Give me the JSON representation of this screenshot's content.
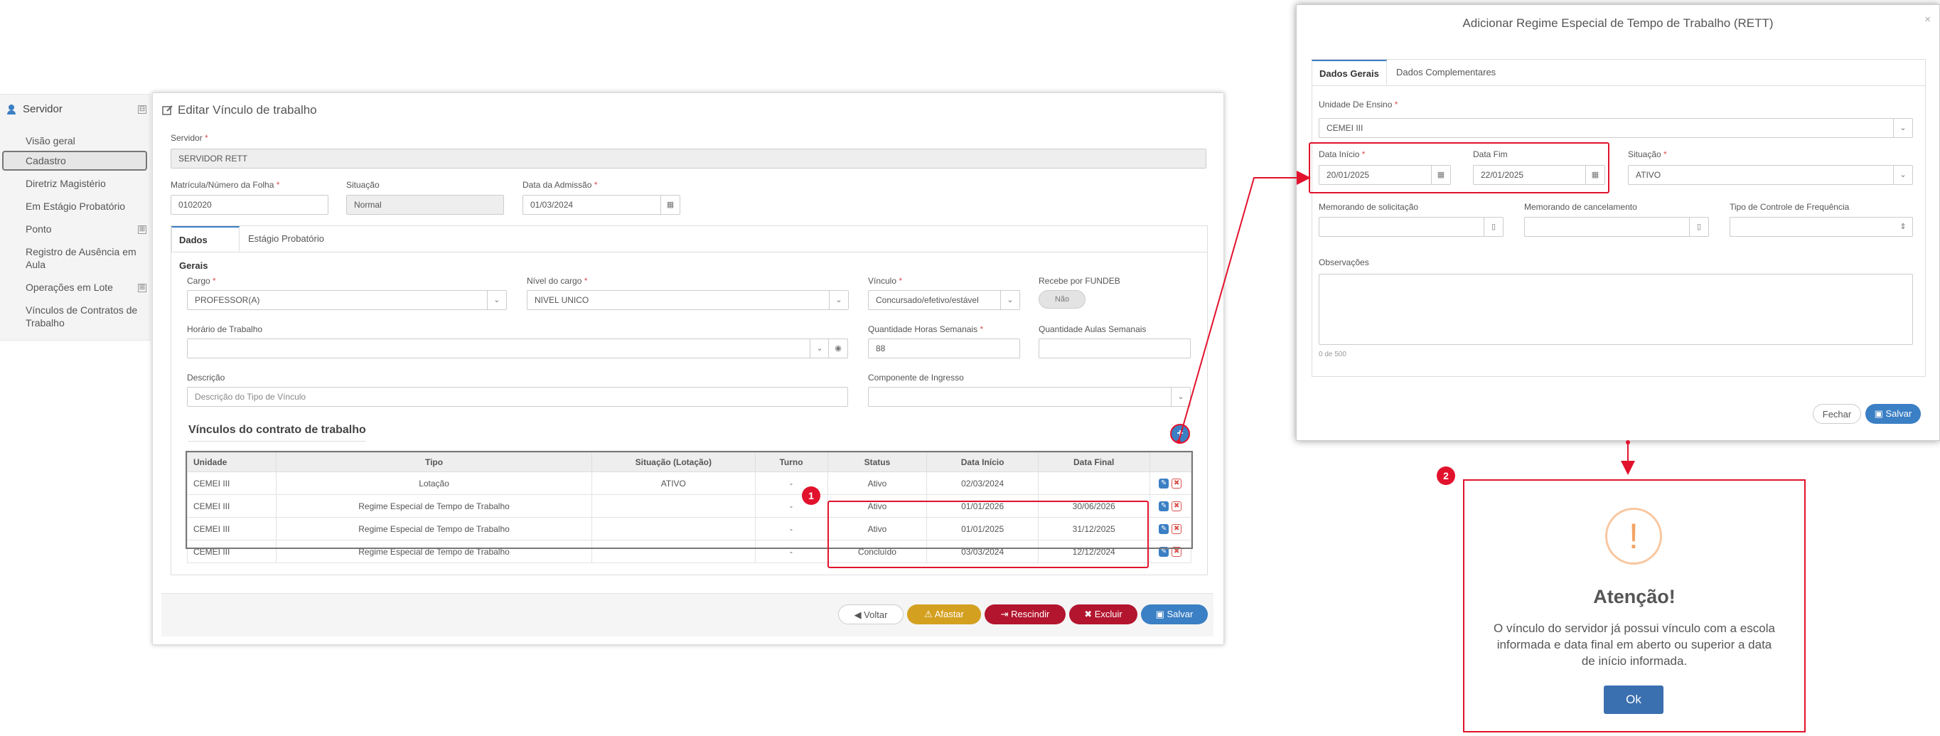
{
  "sidebar": {
    "header": "Servidor",
    "collapse_glyph": "⊟",
    "expand_glyph": "⊞",
    "items": [
      {
        "label": "Visão geral"
      },
      {
        "label": "Cadastro"
      },
      {
        "label": "Diretriz Magistério"
      },
      {
        "label": "Em Estágio Probatório"
      },
      {
        "label": "Ponto"
      },
      {
        "label": "Registro de Ausência em Aula"
      },
      {
        "label": "Operações em Lote"
      },
      {
        "label": "Vínculos de Contratos de Trabalho"
      }
    ]
  },
  "main": {
    "title": "Editar Vínculo de trabalho",
    "servidor_label": "Servidor",
    "servidor_value": "SERVIDOR RETT",
    "matricula_label": "Matrícula/Número da Folha",
    "matricula_value": "0102020",
    "situacao_label": "Situação",
    "situacao_value": "Normal",
    "admissao_label": "Data da Admissão",
    "admissao_value": "01/03/2024",
    "tabs": [
      {
        "label": "Dados Gerais"
      },
      {
        "label": "Estágio Probatório"
      }
    ],
    "cargo_label": "Cargo",
    "cargo_value": "PROFESSOR(A)",
    "nivel_label": "Nível do cargo",
    "nivel_value": "NIVEL UNICO",
    "vinculo_label": "Vínculo",
    "vinculo_value": "Concursado/efetivo/estável",
    "fundeb_label": "Recebe por FUNDEB",
    "fundeb_value": "Não",
    "horario_label": "Horário de Trabalho",
    "horas_label": "Quantidade Horas Semanais",
    "horas_value": "88",
    "aulas_label": "Quantidade Aulas Semanais",
    "descricao_label": "Descrição",
    "descricao_placeholder": "Descrição do Tipo de Vínculo",
    "componente_label": "Componente de Ingresso",
    "contratos_title": "Vínculos do contrato de trabalho",
    "table": {
      "headers": [
        "Unidade",
        "Tipo",
        "Situação (Lotação)",
        "Turno",
        "Status",
        "Data Início",
        "Data Final",
        ""
      ],
      "rows": [
        [
          "CEMEI III",
          "Lotação",
          "ATIVO",
          "-",
          "Ativo",
          "02/03/2024",
          ""
        ],
        [
          "CEMEI III",
          "Regime Especial de Tempo de Trabalho",
          "",
          "-",
          "Ativo",
          "01/01/2026",
          "30/06/2026"
        ],
        [
          "CEMEI III",
          "Regime Especial de Tempo de Trabalho",
          "",
          "-",
          "Ativo",
          "01/01/2025",
          "31/12/2025"
        ],
        [
          "CEMEI III",
          "Regime Especial de Tempo de Trabalho",
          "",
          "-",
          "Concluído",
          "03/03/2024",
          "12/12/2024"
        ]
      ]
    },
    "buttons": {
      "voltar": "Voltar",
      "afastar": "Afastar",
      "rescindir": "Rescindir",
      "excluir": "Excluir",
      "salvar": "Salvar"
    }
  },
  "modal": {
    "title": "Adicionar Regime Especial de Tempo de Trabalho (RETT)",
    "tabs": [
      {
        "label": "Dados Gerais"
      },
      {
        "label": "Dados Complementares"
      }
    ],
    "unidade_label": "Unidade De Ensino",
    "unidade_value": "CEMEI III",
    "inicio_label": "Data Início",
    "inicio_value": "20/01/2025",
    "fim_label": "Data Fim",
    "fim_value": "22/01/2025",
    "situacao_label": "Situação",
    "situacao_value": "ATIVO",
    "memo_sol_label": "Memorando de solicitação",
    "memo_can_label": "Memorando de cancelamento",
    "controle_label": "Tipo de Controle de Frequência",
    "obs_label": "Observações",
    "obs_counter": "0 de 500",
    "fechar": "Fechar",
    "salvar": "Salvar"
  },
  "alert": {
    "title": "Atenção!",
    "message": "O vínculo do servidor já possui vínculo com a escola informada e data final em aberto ou superior a data de início informada.",
    "ok": "Ok"
  },
  "annotations": {
    "badge1": "1",
    "badge2": "2"
  },
  "colors": {
    "accent": "#3b7fc4",
    "annotation": "#e2122d",
    "warning": "#d4a020",
    "danger": "#b3152e"
  }
}
